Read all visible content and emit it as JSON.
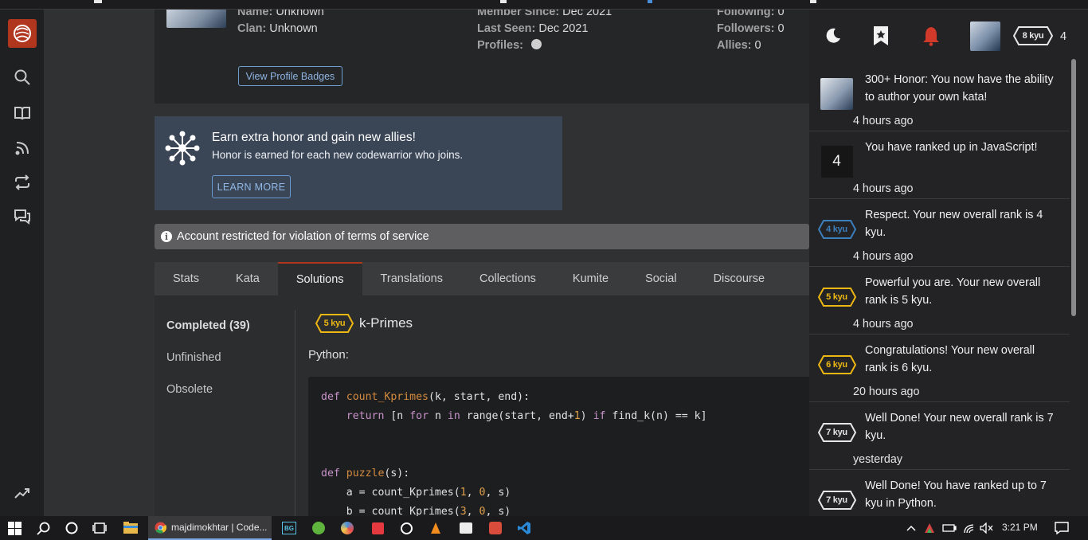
{
  "profile": {
    "name_label": "Name:",
    "name_value": "Unknown",
    "clan_label": "Clan:",
    "clan_value": "Unknown",
    "member_since_label": "Member Since:",
    "member_since_value": "Dec 2021",
    "last_seen_label": "Last Seen:",
    "last_seen_value": "Dec 2021",
    "profiles_label": "Profiles:",
    "following_label": "Following:",
    "following_value": "0",
    "followers_label": "Followers:",
    "followers_value": "0",
    "allies_label": "Allies:",
    "allies_value": "0",
    "badges_button": "View Profile Badges"
  },
  "invite": {
    "title": "Earn extra honor and gain new allies!",
    "subtitle": "Honor is earned for each new codewarrior who joins.",
    "button": "LEARN MORE"
  },
  "restriction": {
    "message": "Account restricted for violation of terms of service"
  },
  "tabs": [
    {
      "label": "Stats"
    },
    {
      "label": "Kata"
    },
    {
      "label": "Solutions",
      "active": true
    },
    {
      "label": "Translations"
    },
    {
      "label": "Collections"
    },
    {
      "label": "Kumite"
    },
    {
      "label": "Social"
    },
    {
      "label": "Discourse"
    }
  ],
  "subnav": {
    "completed": "Completed (39)",
    "unfinished": "Unfinished",
    "obsolete": "Obsolete"
  },
  "solution": {
    "rank": "5 kyu",
    "rank_color": "#ecb613",
    "title": "k-Primes",
    "language": "Python:",
    "code": {
      "l1_def": "def",
      "l1_fn": "count_Kprimes",
      "l1_rest": "(k, start, end):",
      "l2_ret": "return",
      "l2_a": "[n",
      "l2_for": "for",
      "l2_b": "n",
      "l2_in": "in",
      "l2_c": "range(start, end+",
      "l2_one": "1",
      "l2_d": ")",
      "l2_if": "if",
      "l2_e": "find_k(n) == k]",
      "l5_def": "def",
      "l5_fn": "puzzle",
      "l5_rest": "(s):",
      "l6_a": "a = count_Kprimes(",
      "l6_1": "1",
      "l6_b": ", ",
      "l6_0": "0",
      "l6_c": ", s)",
      "l7_a": "b = count_Kprimes(",
      "l7_3": "3",
      "l7_b": ", ",
      "l7_0": "0",
      "l7_c": ", s)"
    }
  },
  "notifications_header": {
    "icons": [
      "moon-icon",
      "bookmark-icon",
      "bell-icon"
    ],
    "bell_color": "#d13a2a",
    "user_rank": "8 kyu",
    "honor": "4"
  },
  "notifications": [
    {
      "icon": "avatar",
      "text": "300+ Honor: You now have the ability to author your own kata!",
      "time": "4 hours ago"
    },
    {
      "icon": "number",
      "number": "4",
      "text": "You have ranked up in JavaScript!",
      "time": "4 hours ago"
    },
    {
      "icon": "rank",
      "rank": "4 kyu",
      "color": "#3c7ebb",
      "text": "Respect. Your new overall rank is 4 kyu.",
      "time": "4 hours ago"
    },
    {
      "icon": "rank",
      "rank": "5 kyu",
      "color": "#ecb613",
      "text": "Powerful you are. Your new overall rank is 5 kyu.",
      "time": "4 hours ago"
    },
    {
      "icon": "rank",
      "rank": "6 kyu",
      "color": "#ecb613",
      "text": "Congratulations! Your new overall rank is 6 kyu.",
      "time": "20 hours ago"
    },
    {
      "icon": "rank",
      "rank": "7 kyu",
      "color": "#e6e6e6",
      "text": "Well Done! Your new overall rank is 7 kyu.",
      "time": "yesterday"
    },
    {
      "icon": "rank",
      "rank": "7 kyu",
      "color": "#e6e6e6",
      "text": "Well Done! You have ranked up to 7 kyu in Python.",
      "time": ""
    }
  ],
  "taskbar": {
    "chrome_title": "majdimokhtar | Code...",
    "time": "3:21 PM"
  }
}
